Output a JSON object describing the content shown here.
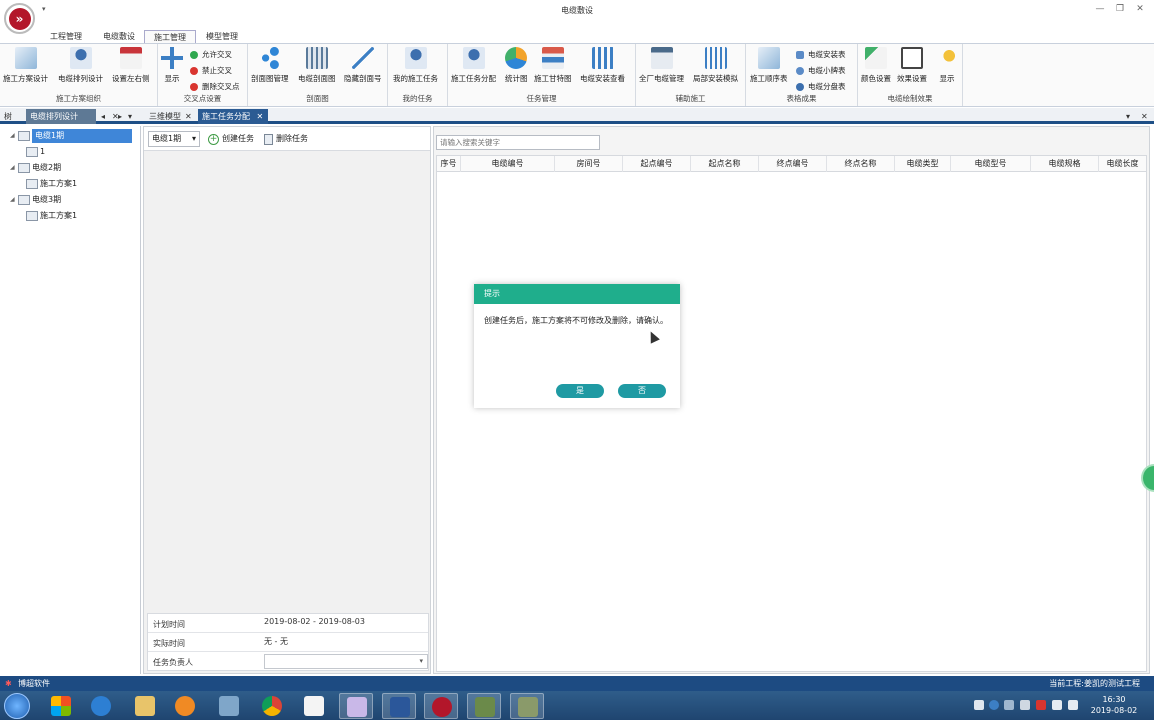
{
  "window": {
    "title": "电缆敷设",
    "quick_access": "▾",
    "min": "—",
    "max": "❐",
    "close": "✕"
  },
  "menu_tabs": [
    {
      "label": "工程管理"
    },
    {
      "label": "电缆敷设"
    },
    {
      "label": "施工管理"
    },
    {
      "label": "模型管理"
    }
  ],
  "ribbon": {
    "g1": {
      "name": "施工方案组织",
      "buttons": [
        "施工方案设计",
        "电缆排列设计",
        "设置左右侧"
      ]
    },
    "g2": {
      "name": "交叉点设置",
      "show": "显示",
      "allow": "允许交叉",
      "forbid": "禁止交叉",
      "delete": "删除交叉点"
    },
    "g3": {
      "name": "剖面图",
      "buttons": [
        "剖面图管理",
        "电缆剖面图",
        "隐藏剖面号"
      ]
    },
    "g4": {
      "name": "我的任务",
      "buttons": [
        "我的施工任务"
      ]
    },
    "g5": {
      "name": "任务管理",
      "buttons": [
        "施工任务分配",
        "统计图",
        "施工甘特图",
        "电缆安装查看"
      ]
    },
    "g6": {
      "name": "辅助施工",
      "buttons": [
        "全厂电缆管理",
        "局部安装模拟"
      ]
    },
    "g7": {
      "name": "表格成果",
      "schedule": "施工顺序表",
      "install_table": "电缆安装表",
      "small_label": "电缆小牌表",
      "split_table": "电缆分盘表"
    },
    "g8": {
      "name": "电缆绘制效果",
      "buttons": [
        "颜色设置",
        "效果设置",
        "显示"
      ]
    }
  },
  "doc_tabs": {
    "left": [
      {
        "label": "树"
      },
      {
        "label": "电缆排列设计"
      }
    ],
    "nav": [
      "◂",
      "▸",
      "▾"
    ],
    "main": [
      {
        "label": "三维模型"
      },
      {
        "label": "施工任务分配"
      }
    ],
    "close": "✕",
    "right_controls": [
      "▾",
      "✕"
    ]
  },
  "tree": {
    "items": [
      {
        "label": "电缆1期",
        "level": 0,
        "toggle": "◢"
      },
      {
        "label": "1",
        "level": 1,
        "toggle": ""
      },
      {
        "label": "电缆2期",
        "level": 0,
        "toggle": "◢"
      },
      {
        "label": "施工方案1",
        "level": 1,
        "toggle": ""
      },
      {
        "label": "电缆3期",
        "level": 0,
        "toggle": "◢"
      },
      {
        "label": "施工方案1",
        "level": 1,
        "toggle": ""
      }
    ]
  },
  "task_panel": {
    "combo_value": "电缆1期",
    "combo_arrow": "▾",
    "create_task": "创建任务",
    "delete_task": "删除任务",
    "props": [
      {
        "label": "计划时间",
        "value": "2019-08-02 - 2019-08-03"
      },
      {
        "label": "实际时间",
        "value": "无 - 无"
      },
      {
        "label": "任务负责人",
        "value": ""
      }
    ],
    "owner_arrow": "▾"
  },
  "grid": {
    "search_placeholder": "请输入搜索关键字",
    "columns": [
      "序号",
      "电缆编号",
      "房间号",
      "起点编号",
      "起点名称",
      "终点编号",
      "终点名称",
      "电缆类型",
      "电缆型号",
      "电缆规格",
      "电缆长度"
    ]
  },
  "dialog": {
    "title": "提示",
    "message": "创建任务后，施工方案将不可修改及删除，请确认。",
    "yes": "是",
    "no": "否"
  },
  "status": {
    "left": "博超软件",
    "right": "当前工程:姜凯的测试工程"
  },
  "taskbar": {
    "time": "16:30",
    "date": "2019-08-02",
    "apps": [
      "explorer-icon",
      "ie-icon",
      "folder-icon",
      "media-icon",
      "tool-icon",
      "chrome-icon",
      "file-icon",
      "ide-icon",
      "word-icon",
      "cable-app-icon",
      "app-icon-1",
      "app-icon-2"
    ]
  },
  "colors": {
    "accent": "#1e4f86",
    "dialog_header": "#1fae8c",
    "dialog_button": "#1f9aa3",
    "brand": "#b3162a"
  }
}
